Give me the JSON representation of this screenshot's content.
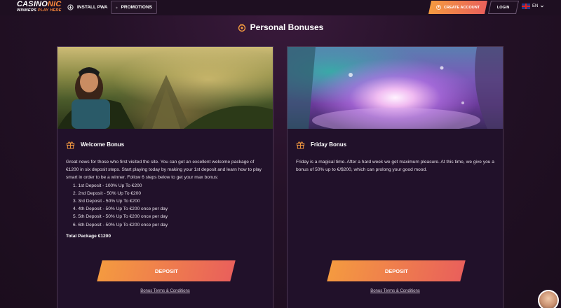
{
  "header": {
    "logo_main": "CASINO",
    "logo_accent": "NIC",
    "logo_tag_a": "WINNERS",
    "logo_tag_b": "PLAY HERE",
    "install_label": "INSTALL PWA",
    "promotions_label": "PROMOTIONS",
    "create_account_label": "CREATE ACCOUNT",
    "login_label": "LOGIN",
    "language": "EN"
  },
  "page_title": "Personal Bonuses",
  "cards": [
    {
      "title": "Welcome Bonus",
      "intro": "Great news for those who first visited the site. You can get an excellent welcome package of €1200 in six deposit steps. Start playing today by making your 1st deposit and learn how to play smart in order to be a winner. Follow 6 steps below to get your max bonus:",
      "steps": [
        "1. 1st Deposit - 100% Up To €200",
        "2. 2nd Deposit - 50% Up To €200",
        "3. 3rd Deposit - 50% Up To €200",
        "4. 4th Deposit - 50% Up To €200 once per day",
        "5. 5th Deposit - 50% Up To €200 once per day",
        "6. 6th Deposit - 50% Up To €200 once per day"
      ],
      "total": "Total Package €1200",
      "button": "DEPOSIT",
      "terms": "Bonus Terms & Conditions"
    },
    {
      "title": "Friday Bonus",
      "intro": "Friday is a magical time. After a hard week we get maximum pleasure. At this time, we give you a bonus of 50% up to €/$200, which can prolong your good mood.",
      "button": "DEPOSIT",
      "terms": "Bonus Terms & Conditions"
    }
  ],
  "colors": {
    "accent_start": "#f49a40",
    "accent_end": "#e9605b",
    "background": "#241127",
    "card": "#21112a"
  },
  "icons": [
    "pwa-download-icon",
    "promotions-icon",
    "user-icon",
    "uk-flag-icon",
    "chevron-down-icon",
    "bonus-coin-icon",
    "gift-icon",
    "support-avatar"
  ]
}
